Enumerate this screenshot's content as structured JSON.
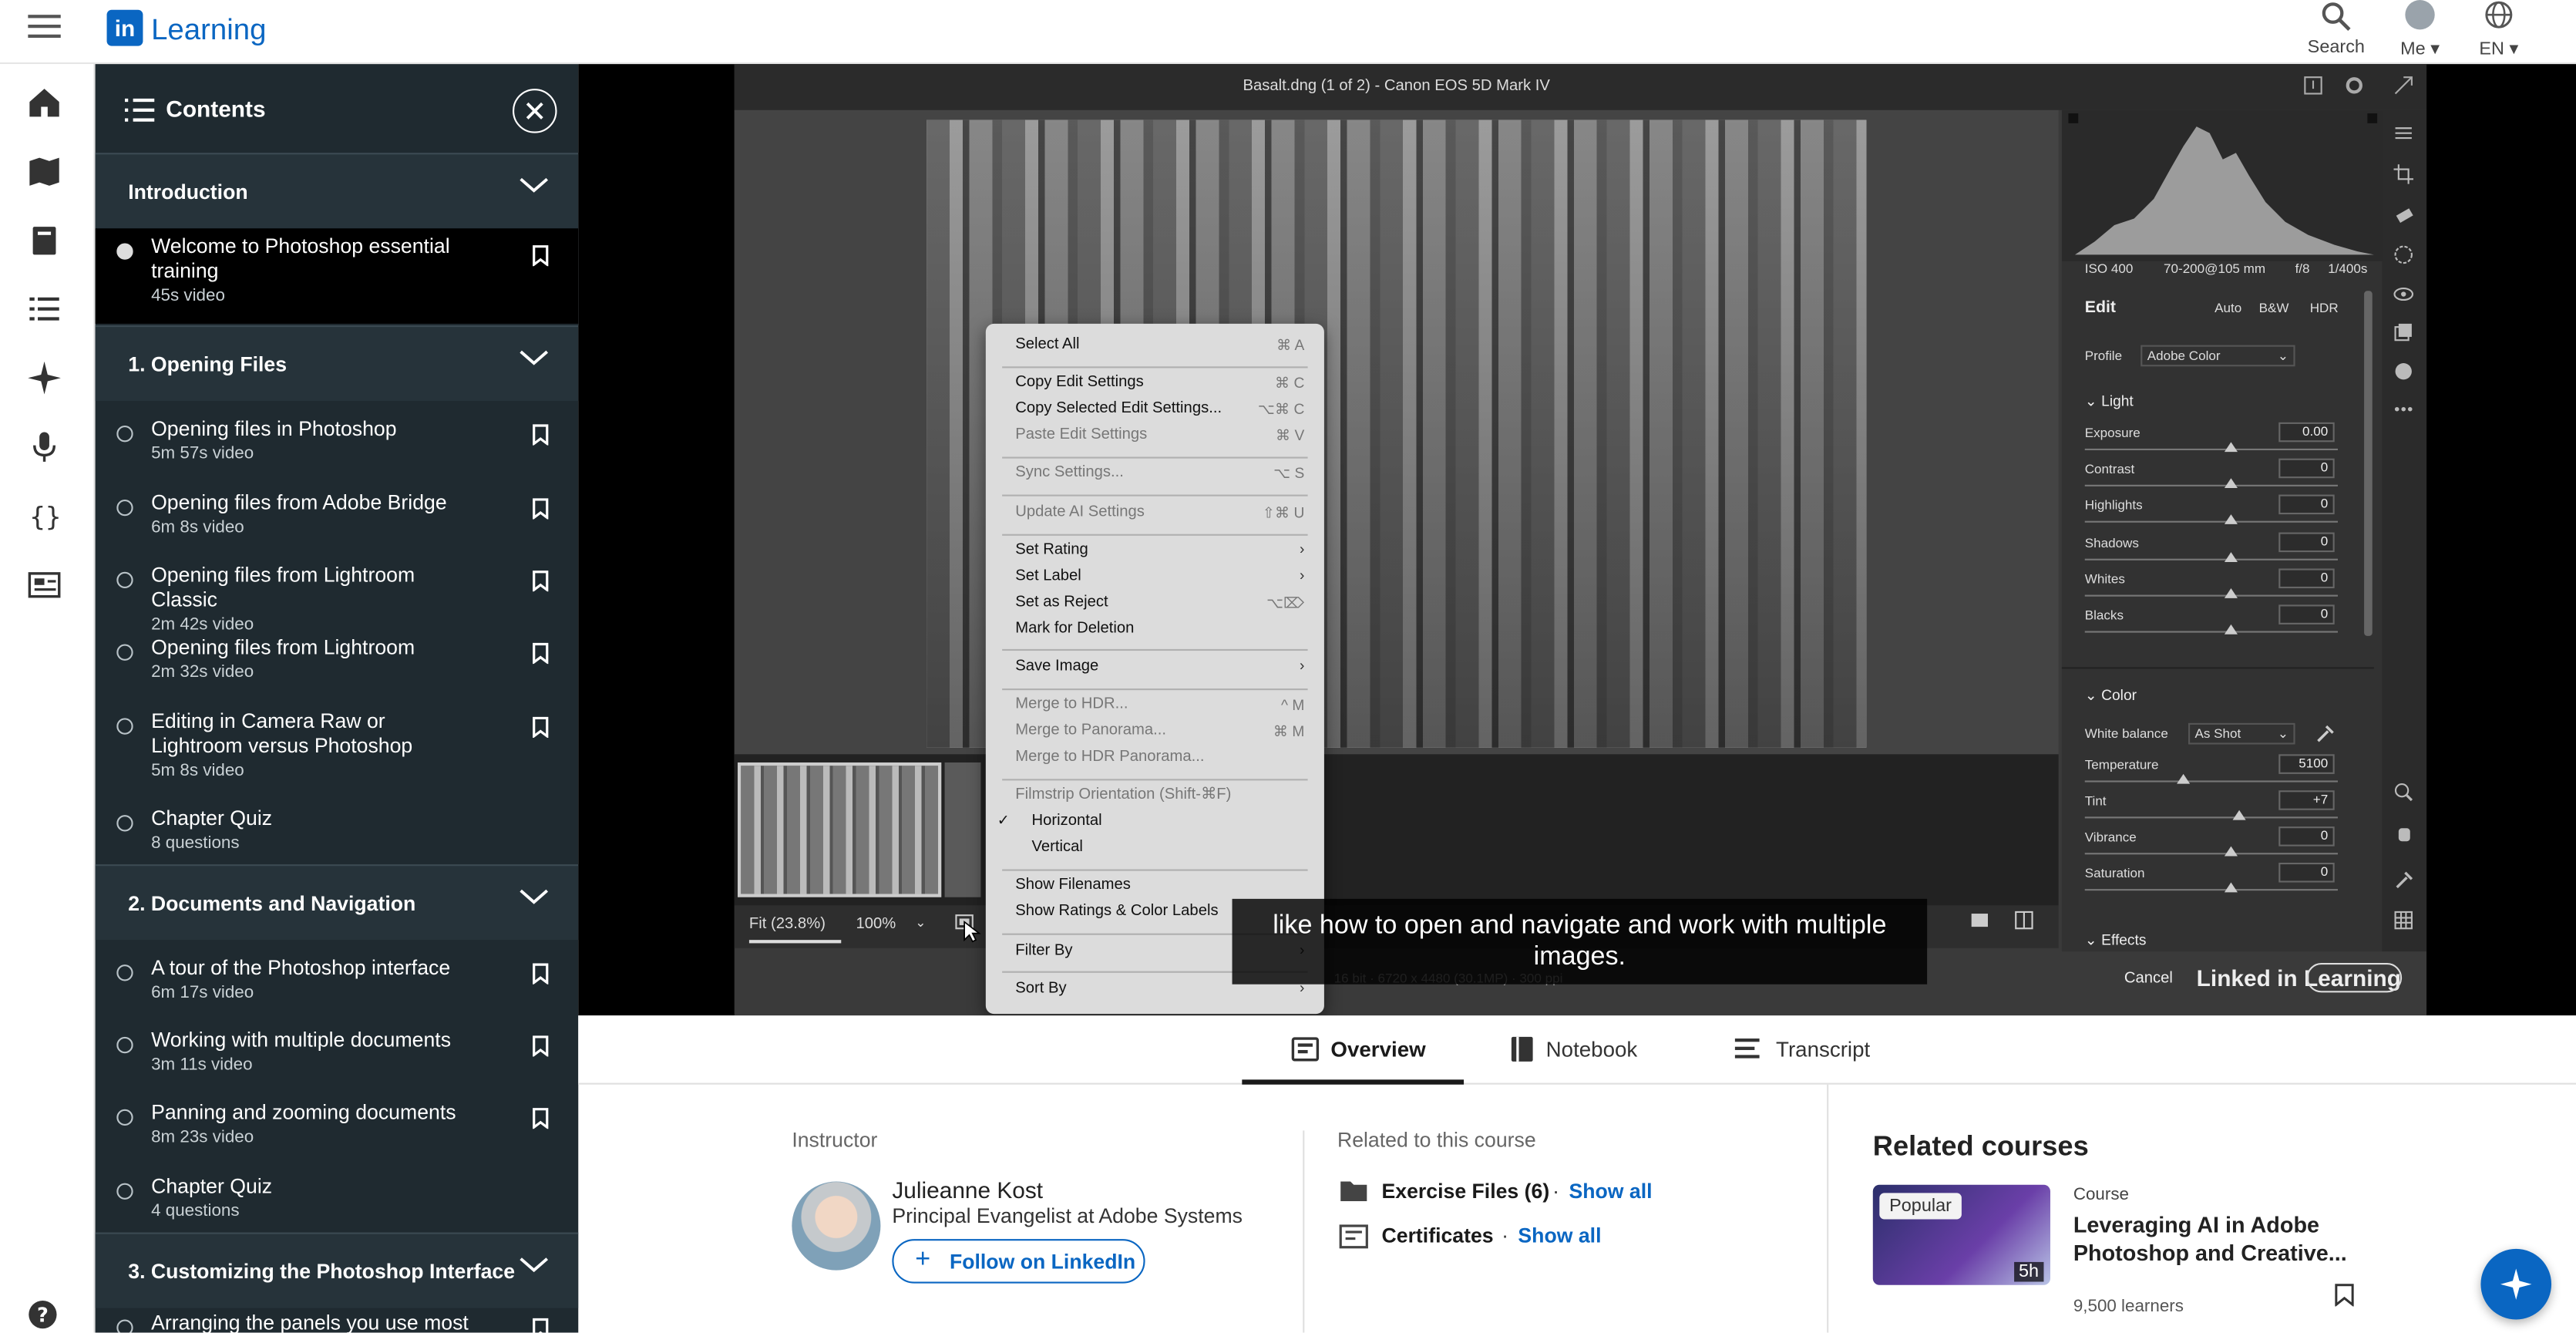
{
  "header": {
    "brand_text": "Learning",
    "search_label": "Search",
    "me_label": "Me",
    "lang_label": "EN"
  },
  "contents": {
    "title": "Contents",
    "sections": [
      {
        "title": "Introduction",
        "items": [
          {
            "title": "Welcome to Photoshop essential training",
            "sub": "45s video",
            "active": true
          }
        ]
      },
      {
        "title": "1. Opening Files",
        "items": [
          {
            "title": "Opening files in Photoshop",
            "sub": "5m 57s video"
          },
          {
            "title": "Opening files from Adobe Bridge",
            "sub": "6m 8s video"
          },
          {
            "title": "Opening files from Lightroom Classic",
            "sub": "2m 42s video"
          },
          {
            "title": "Opening files from Lightroom",
            "sub": "2m 32s video"
          },
          {
            "title": "Editing in Camera Raw or Lightroom versus Photoshop",
            "sub": "5m 8s video"
          },
          {
            "title": "Chapter Quiz",
            "sub": "8 questions"
          }
        ]
      },
      {
        "title": "2. Documents and Navigation",
        "items": [
          {
            "title": "A tour of the Photoshop interface",
            "sub": "6m 17s video"
          },
          {
            "title": "Working with multiple documents",
            "sub": "3m 11s video"
          },
          {
            "title": "Panning and zooming documents",
            "sub": "8m 23s video"
          },
          {
            "title": "Chapter Quiz",
            "sub": "4 questions"
          }
        ]
      },
      {
        "title": "3. Customizing the Photoshop Interface",
        "items": [
          {
            "title": "Arranging the panels you use most",
            "sub": ""
          }
        ]
      }
    ]
  },
  "video": {
    "window_title": "Basalt.dng (1 of 2)  -  Canon EOS 5D Mark IV",
    "iso": "ISO 400",
    "lens": "70-200@105 mm",
    "aperture": "f/8",
    "shutter": "1/400s",
    "edit_label": "Edit",
    "auto": "Auto",
    "bw": "B&W",
    "hdr": "HDR",
    "profile_label": "Profile",
    "profile_value": "Adobe Color",
    "light_label": "Light",
    "light_sliders": [
      {
        "name": "Exposure",
        "value": "0.00",
        "pos": 0.58
      },
      {
        "name": "Contrast",
        "value": "0",
        "pos": 0.58
      },
      {
        "name": "Highlights",
        "value": "0",
        "pos": 0.58
      },
      {
        "name": "Shadows",
        "value": "0",
        "pos": 0.58
      },
      {
        "name": "Whites",
        "value": "0",
        "pos": 0.58
      },
      {
        "name": "Blacks",
        "value": "0",
        "pos": 0.58
      }
    ],
    "color_label": "Color",
    "wb_label": "White balance",
    "wb_value": "As Shot",
    "color_sliders": [
      {
        "name": "Temperature",
        "value": "5100",
        "pos": 0.39
      },
      {
        "name": "Tint",
        "value": "+7",
        "pos": 0.61
      },
      {
        "name": "Vibrance",
        "value": "0",
        "pos": 0.58
      },
      {
        "name": "Saturation",
        "value": "0",
        "pos": 0.58
      }
    ],
    "effects_label": "Effects",
    "fit_label": "Fit (23.8%)",
    "zoom_label": "100%",
    "cancel_label": "Cancel",
    "watermark": "Linked in Learning",
    "caption": "like how to open and navigate and work with multiple images.",
    "context_menu": [
      {
        "label": "Select All",
        "sc": "⌘ A"
      },
      {
        "sep": true
      },
      {
        "label": "Copy Edit Settings",
        "sc": "⌘ C"
      },
      {
        "label": "Copy Selected Edit Settings...",
        "sc": "⌥⌘ C"
      },
      {
        "label": "Paste Edit Settings",
        "sc": "⌘ V",
        "dis": true
      },
      {
        "sep": true
      },
      {
        "label": "Sync Settings...",
        "sc": "⌥ S",
        "dis": true
      },
      {
        "sep": true
      },
      {
        "label": "Update AI Settings",
        "sc": "⇧⌘ U",
        "dis": true
      },
      {
        "sep": true
      },
      {
        "label": "Set Rating",
        "arrow": true
      },
      {
        "label": "Set Label",
        "arrow": true
      },
      {
        "label": "Set as Reject",
        "sc": "⌥⌦"
      },
      {
        "label": "Mark for Deletion"
      },
      {
        "sep": true
      },
      {
        "label": "Save Image",
        "arrow": true
      },
      {
        "sep": true
      },
      {
        "label": "Merge to HDR...",
        "sc": "^ M",
        "dis": true
      },
      {
        "label": "Merge to Panorama...",
        "sc": "⌘ M",
        "dis": true
      },
      {
        "label": "Merge to HDR Panorama...",
        "dis": true
      },
      {
        "sep": true
      },
      {
        "label": "Filmstrip Orientation (Shift-⌘F)",
        "dis": true
      },
      {
        "label": "Horizontal",
        "check": true,
        "indent": true
      },
      {
        "label": "Vertical",
        "indent": true
      },
      {
        "sep": true
      },
      {
        "label": "Show Filenames"
      },
      {
        "label": "Show Ratings & Color Labels"
      },
      {
        "sep": true
      },
      {
        "label": "Filter By",
        "arrow": true
      },
      {
        "sep": true
      },
      {
        "label": "Sort By",
        "arrow": true
      }
    ]
  },
  "tabs": [
    {
      "label": "Overview",
      "active": true
    },
    {
      "label": "Notebook"
    },
    {
      "label": "Transcript"
    }
  ],
  "overview": {
    "instructor_label": "Instructor",
    "instructor_name": "Julieanne Kost",
    "instructor_title": "Principal Evangelist at Adobe Systems",
    "follow_label": "Follow on LinkedIn",
    "related_label": "Related to this course",
    "exercise_label": "Exercise Files (6)",
    "certificates_label": "Certificates",
    "show_all": "Show all"
  },
  "related_courses": {
    "title": "Related courses",
    "course": {
      "badge": "Popular",
      "duration": "5h",
      "type": "Course",
      "title": "Leveraging AI in Adobe Photoshop and Creative...",
      "learners": "9,500 learners"
    }
  },
  "colors": {
    "brand": "#0a66c2",
    "panel": "#1f2a30",
    "accent_fab": "#0a66c2"
  }
}
